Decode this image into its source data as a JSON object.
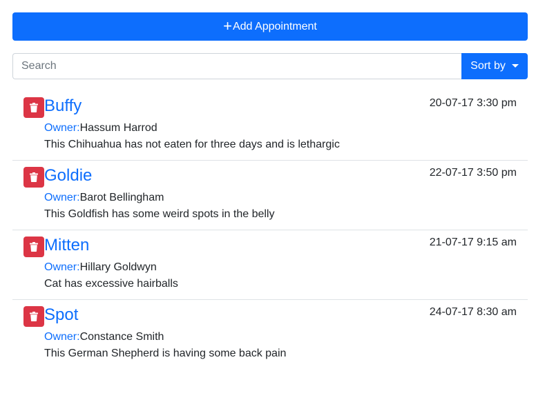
{
  "add_button": {
    "icon": "plus-icon",
    "label": "Add Appointment"
  },
  "search": {
    "placeholder": "Search",
    "value": ""
  },
  "sort_button": {
    "label": "Sort by"
  },
  "colors": {
    "primary": "#0d6efd",
    "danger": "#dc3545",
    "divider": "#dee2e6"
  },
  "appointments": [
    {
      "pet_name": "Buffy",
      "date": "20-07-17 3:30 pm",
      "owner_label": "Owner:",
      "owner": "Hassum Harrod",
      "notes": "This Chihuahua has not eaten for three days and is lethargic"
    },
    {
      "pet_name": "Goldie",
      "date": "22-07-17 3:50 pm",
      "owner_label": "Owner:",
      "owner": "Barot Bellingham",
      "notes": "This Goldfish has some weird spots in the belly"
    },
    {
      "pet_name": "Mitten",
      "date": "21-07-17 9:15 am",
      "owner_label": "Owner:",
      "owner": "Hillary Goldwyn",
      "notes": "Cat has excessive hairballs"
    },
    {
      "pet_name": "Spot",
      "date": "24-07-17 8:30 am",
      "owner_label": "Owner:",
      "owner": "Constance Smith",
      "notes": "This German Shepherd is having some back pain"
    }
  ]
}
